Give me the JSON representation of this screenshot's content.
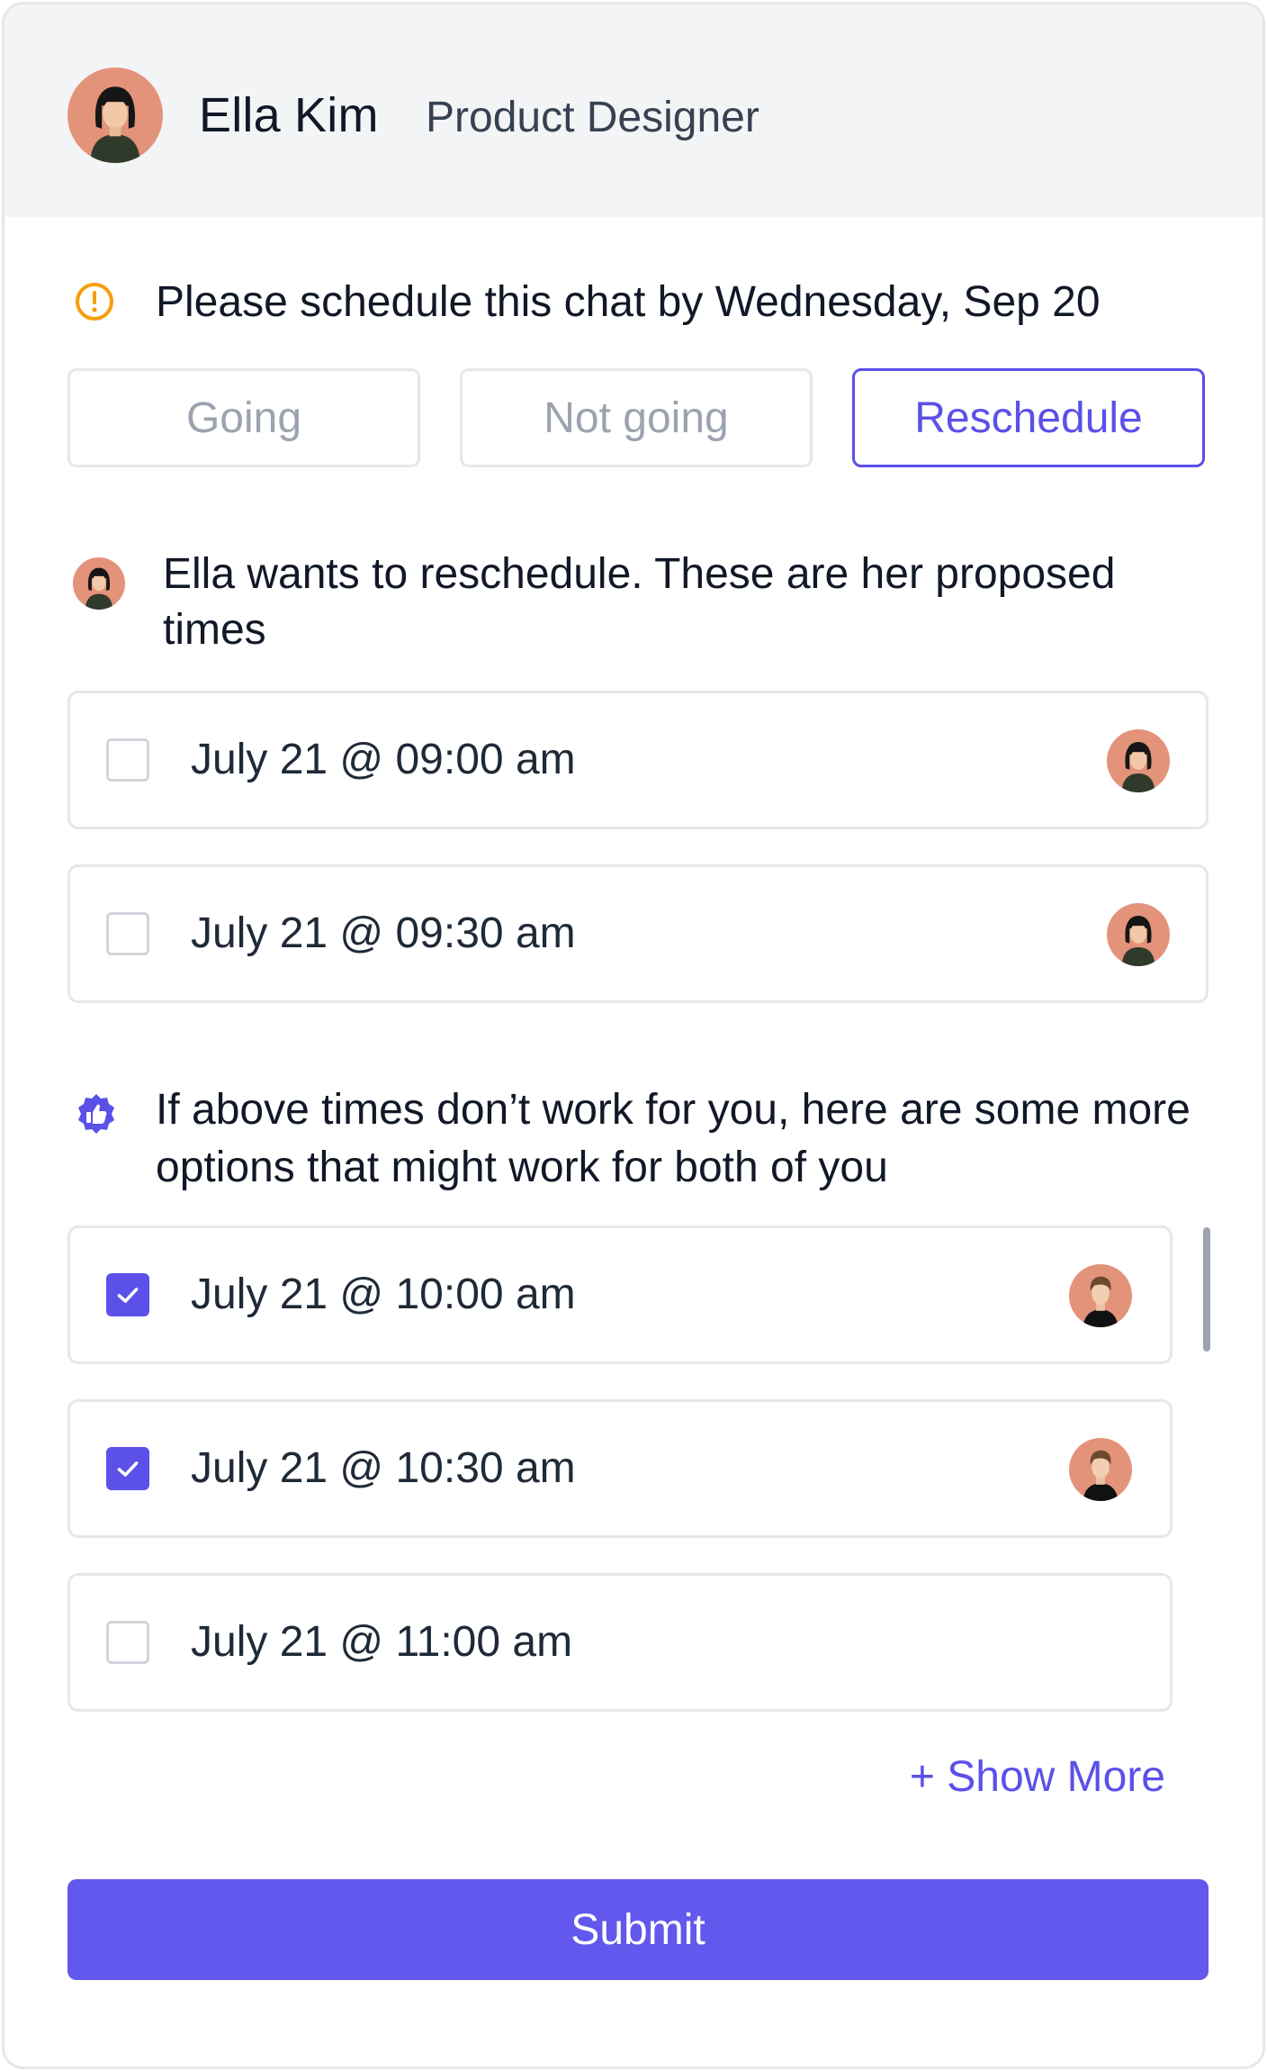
{
  "header": {
    "name": "Ella Kim",
    "role": "Product Designer",
    "avatar_icon": "user-avatar-woman"
  },
  "notice": {
    "icon": "warning-icon",
    "text": "Please schedule this chat by Wednesday, Sep 20",
    "icon_color": "#f59e0b"
  },
  "response_buttons": [
    {
      "label": "Going",
      "active": false
    },
    {
      "label": "Not going",
      "active": false
    },
    {
      "label": "Reschedule",
      "active": true
    }
  ],
  "proposal": {
    "text": "Ella wants to reschedule. These are her proposed times",
    "slots": [
      {
        "label": "July 21 @ 09:00 am",
        "checked": false,
        "avatar": "ella-avatar"
      },
      {
        "label": "July 21 @ 09:30 am",
        "checked": false,
        "avatar": "ella-avatar"
      }
    ]
  },
  "suggestions": {
    "icon": "thumbs-up-badge-icon",
    "text": "If above times don’t work for you, here are some more options that might work for both of you",
    "slots": [
      {
        "label": "July 21 @ 10:00 am",
        "checked": true,
        "avatar": "man-avatar"
      },
      {
        "label": "July 21 @ 10:30 am",
        "checked": true,
        "avatar": "man-avatar"
      },
      {
        "label": "July 21 @ 11:00 am",
        "checked": false,
        "avatar": null
      }
    ],
    "show_more_label": "+ Show More"
  },
  "submit_label": "Submit",
  "colors": {
    "accent": "#5b50e8",
    "submit": "#6258ee",
    "warning": "#f59e0b",
    "avatar_bg": "#e3937a"
  }
}
